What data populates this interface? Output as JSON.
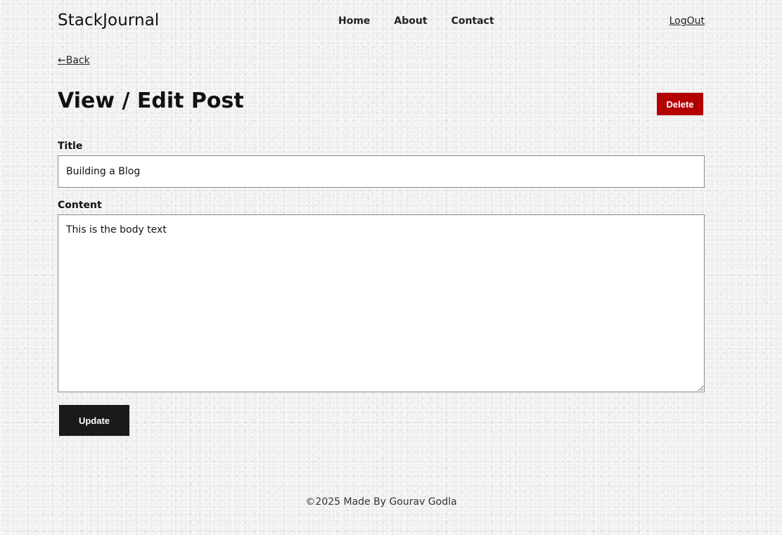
{
  "header": {
    "brand": "StackJournal",
    "nav": [
      {
        "label": "Home"
      },
      {
        "label": "About"
      },
      {
        "label": "Contact"
      }
    ],
    "logout_label": "LogOut"
  },
  "back_label": "←Back",
  "page_title": "View / Edit Post",
  "delete_label": "Delete",
  "form": {
    "title_label": "Title",
    "title_value": "Building a Blog",
    "content_label": "Content",
    "content_value": "This is the body text",
    "update_label": "Update"
  },
  "footer_text": "©2025 Made By Gourav Godla",
  "colors": {
    "delete_button": "#b30000",
    "update_button": "#1a1a1a",
    "background": "#efefef"
  }
}
